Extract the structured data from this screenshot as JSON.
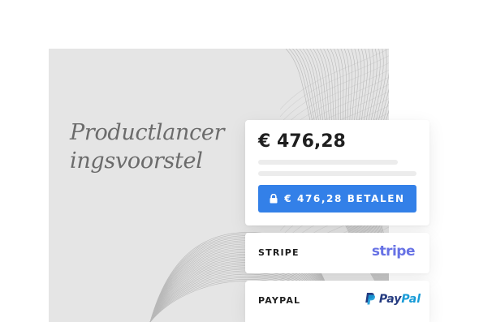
{
  "document": {
    "title_line1": "Productlancer",
    "title_line2": "ingsvoorstel"
  },
  "payment": {
    "amount": "€ 476,28",
    "pay_button_label": "€ 476,28 BETALEN",
    "lock_icon": "lock-icon"
  },
  "methods": [
    {
      "label": "STRIPE",
      "logo_text": "stripe",
      "logo_color": "#6772e5"
    },
    {
      "label": "PAYPAL",
      "logo_text_part1": "Pay",
      "logo_text_part2": "Pal",
      "logo_color_dark": "#253b80",
      "logo_color_light": "#179bd7"
    }
  ],
  "colors": {
    "accent": "#3380e8",
    "doc_background": "#e5e5e5",
    "title_color": "#6b6b6b"
  }
}
